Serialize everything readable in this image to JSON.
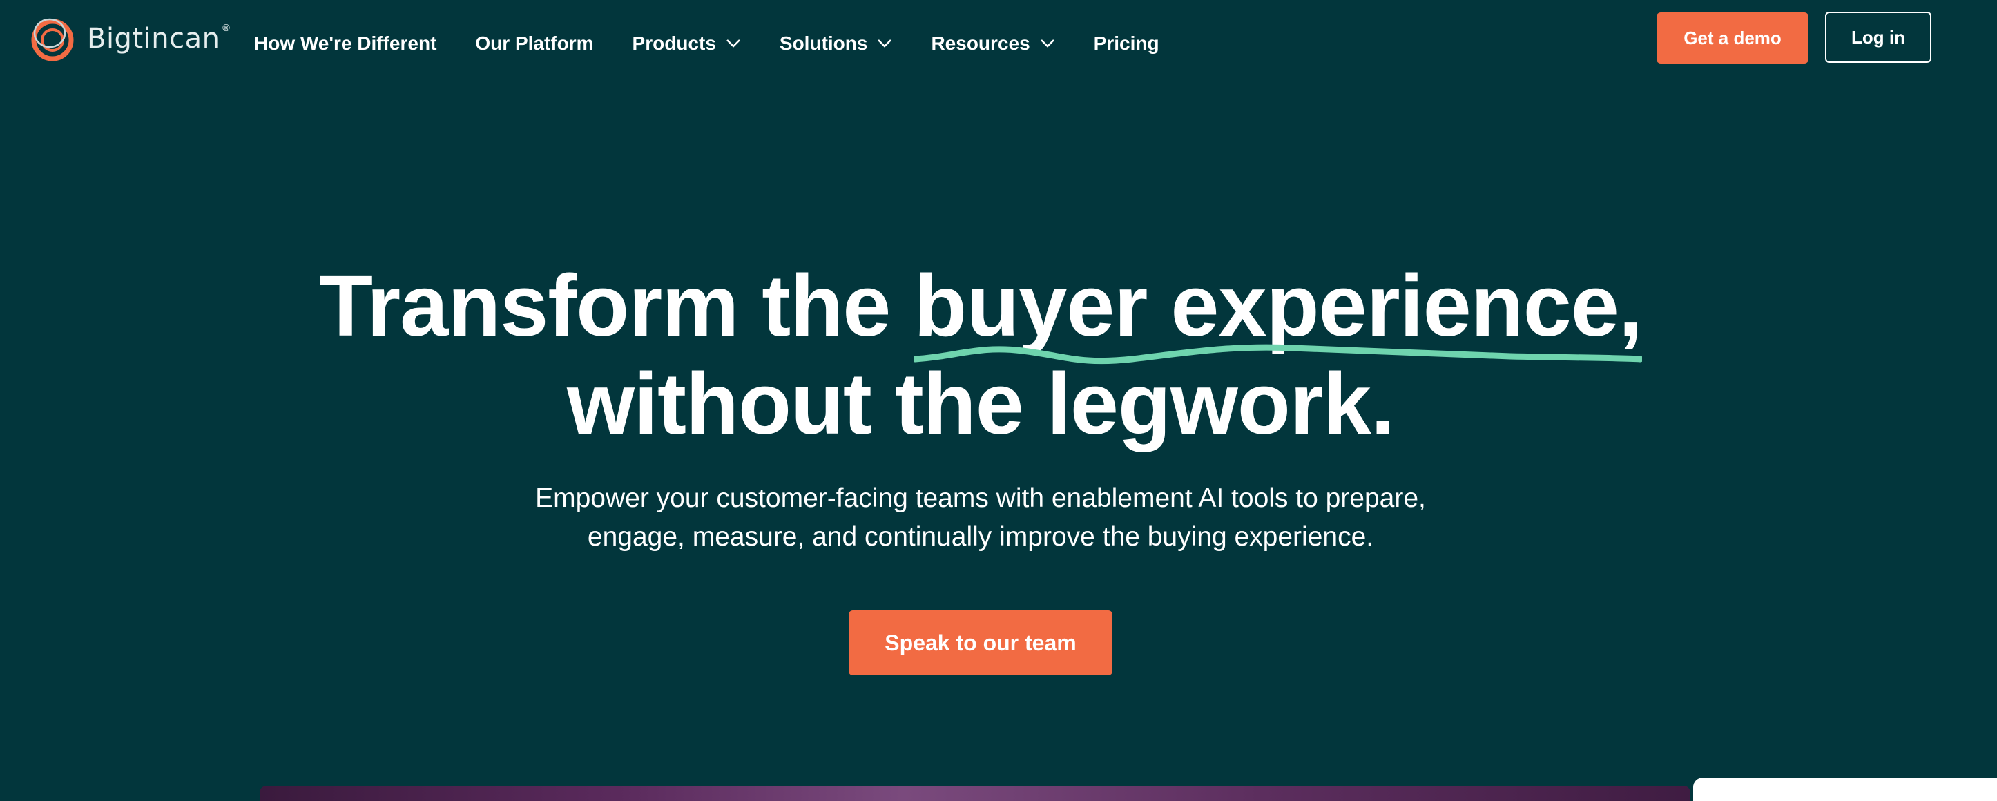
{
  "brand": {
    "name": "Bigtincan",
    "trademark": "®",
    "colors": {
      "background": "#02363c",
      "accent": "#f26b43",
      "highlight": "#6fd4ae",
      "logo_ring": "#f26b43",
      "logo_ring_secondary": "#c9d6d8"
    }
  },
  "nav": {
    "items": [
      {
        "label": "How We're Different",
        "has_dropdown": false
      },
      {
        "label": "Our Platform",
        "has_dropdown": false
      },
      {
        "label": "Products",
        "has_dropdown": true
      },
      {
        "label": "Solutions",
        "has_dropdown": true
      },
      {
        "label": "Resources",
        "has_dropdown": true
      },
      {
        "label": "Pricing",
        "has_dropdown": false
      }
    ],
    "icons": {
      "dropdown": "chevron-down-icon"
    }
  },
  "header": {
    "demo_label": "Get a demo",
    "login_label": "Log in"
  },
  "hero": {
    "title_part1": "Transform the ",
    "title_highlight": "buyer experience,",
    "title_line2": "without the legwork.",
    "subtitle_line1": "Empower your customer-facing teams with enablement AI tools to prepare,",
    "subtitle_line2": "engage, measure, and continually improve the buying experience.",
    "cta_label": "Speak to our team"
  }
}
